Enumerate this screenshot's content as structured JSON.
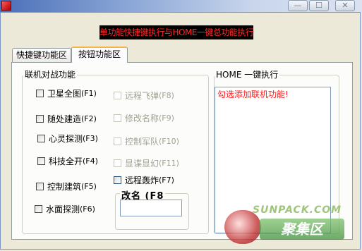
{
  "window": {
    "controls": {
      "minimize": "—",
      "maximize": "☐",
      "close": "✕"
    },
    "icon": "app-icon"
  },
  "banner": "单功能快捷键执行与HOME一键总功能执行",
  "tabs": [
    {
      "label": "快捷键功能区",
      "active": false
    },
    {
      "label": "按钮功能区",
      "active": true
    }
  ],
  "left_group": {
    "title": "联机对战功能",
    "col1": [
      {
        "label": "卫星全图",
        "key": "(F1)",
        "enabled": true
      },
      {
        "label": "随处建造",
        "key": "(F2)",
        "enabled": true
      },
      {
        "label": "心灵探测",
        "key": "(F3)",
        "enabled": true
      },
      {
        "label": "科技全开",
        "key": "(F4)",
        "enabled": true
      },
      {
        "label": "控制建筑",
        "key": "(F5)",
        "enabled": true
      },
      {
        "label": "水面探测",
        "key": "(F6)",
        "enabled": true
      }
    ],
    "col2": [
      {
        "label": "远程飞弹",
        "key": "(F8)",
        "enabled": false
      },
      {
        "label": "修改名称",
        "key": "(F9)",
        "enabled": false
      },
      {
        "label": "控制军队",
        "key": "(F10)",
        "enabled": false
      },
      {
        "label": "显谍显幻",
        "key": "(F11)",
        "enabled": false
      },
      {
        "label": "远程轰炸",
        "key": "(F7)",
        "enabled": true
      }
    ]
  },
  "rename": {
    "title": "改名 (F8",
    "value": ""
  },
  "right_group": {
    "title": "HOME 一键执行",
    "message": "勾选添加联机功能!"
  },
  "watermark": {
    "top": "SUNPACK.COM",
    "bottom": "聚集区"
  },
  "colors": {
    "banner_text": "#ff2a2a",
    "message_text": "#ff1a1a",
    "tab_accent": "#f5b53e"
  }
}
